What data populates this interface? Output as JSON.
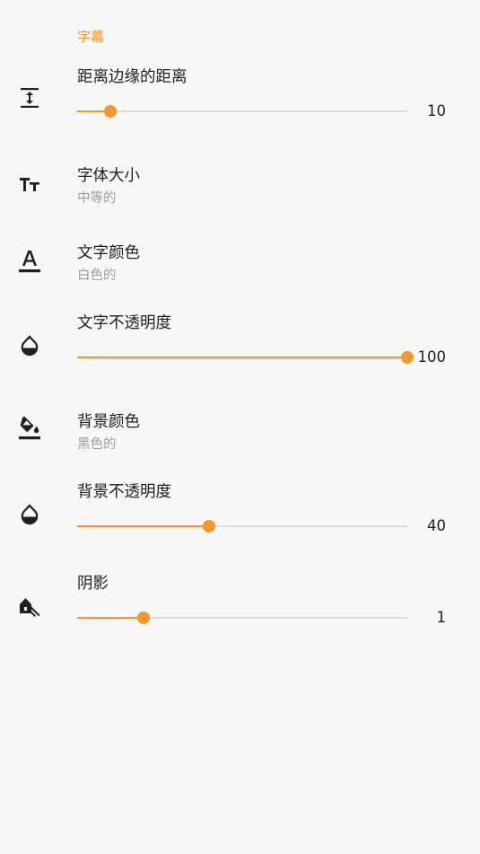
{
  "section": {
    "title": "字幕"
  },
  "colors": {
    "accent": "#f5962e",
    "track": "#dcdcdc",
    "text": "#202020",
    "summary": "#9e9e9e",
    "background": "#f7f7f7"
  },
  "settings": [
    {
      "key": "edge_distance",
      "icon": "vertical-align-icon",
      "title": "距离边缘的距离",
      "type": "slider",
      "value": "10",
      "fraction": 0.1
    },
    {
      "key": "font_size",
      "icon": "text-size-icon",
      "title": "字体大小",
      "type": "list",
      "summary": "中等的"
    },
    {
      "key": "text_color",
      "icon": "text-color-icon",
      "title": "文字颜色",
      "type": "list",
      "summary": "白色的"
    },
    {
      "key": "text_opacity",
      "icon": "opacity-drop-icon",
      "title": "文字不透明度",
      "type": "slider",
      "value": "100",
      "fraction": 1.0
    },
    {
      "key": "background_color",
      "icon": "paint-bucket-icon",
      "title": "背景颜色",
      "type": "list",
      "summary": "黑色的"
    },
    {
      "key": "background_opacity",
      "icon": "opacity-drop-icon",
      "title": "背景不透明度",
      "type": "slider",
      "value": "40",
      "fraction": 0.4
    },
    {
      "key": "shadow",
      "icon": "shadow-icon",
      "title": "阴影",
      "type": "slider",
      "value": "1",
      "fraction": 0.2
    }
  ]
}
